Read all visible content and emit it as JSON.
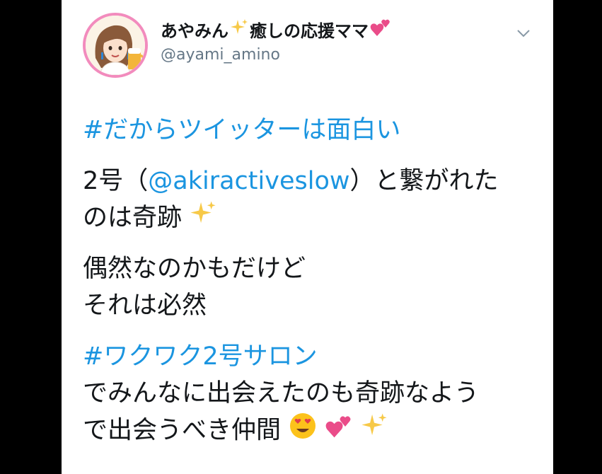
{
  "tweet": {
    "display_name": "あやみん",
    "display_name_suffix": "癒しの応援ママ",
    "handle": "@ayami_amino",
    "line1_hashtag": "#だからツイッターは面白い",
    "line2_prefix": "2号（",
    "line2_mention": "@akiractiveslow",
    "line2_suffix": "）と繋がれた",
    "line3": "のは奇跡",
    "line4": "偶然なのかもだけど",
    "line5": "それは必然",
    "line6_hashtag": "#ワクワク2号サロン",
    "line7": "でみんなに出会えたのも奇跡なよう",
    "line8": "で出会うべき仲間"
  },
  "icons": [
    "sparkles-icon",
    "two-hearts-icon",
    "heart-eyes-icon",
    "chevron-down-icon"
  ],
  "colors": {
    "link": "#1b95e0",
    "text": "#14171a",
    "handle": "#657786",
    "avatar_border": "#f28bbd"
  }
}
